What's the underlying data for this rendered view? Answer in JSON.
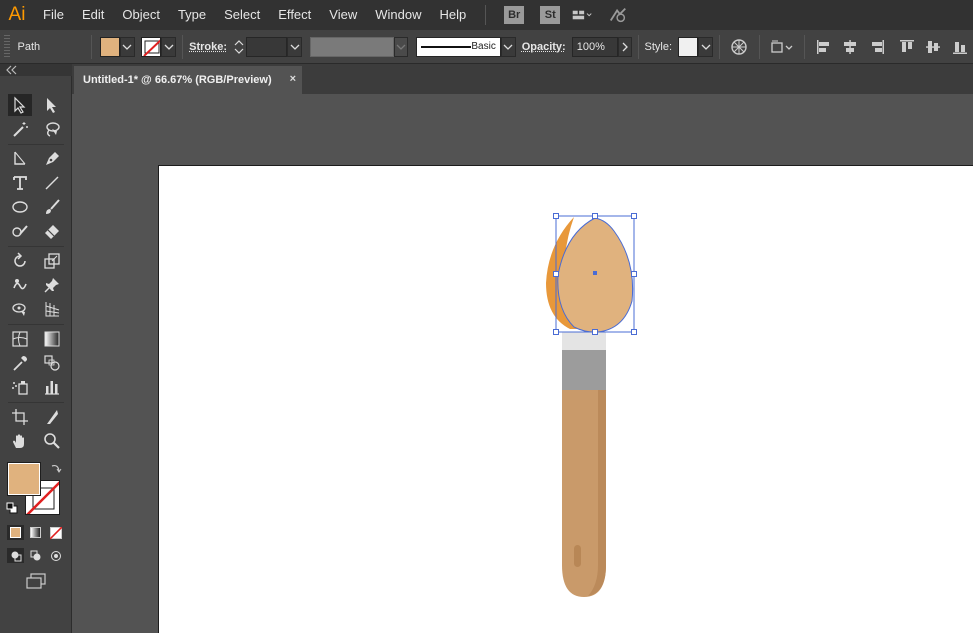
{
  "app": {
    "logo": "Ai"
  },
  "menu": [
    "File",
    "Edit",
    "Object",
    "Type",
    "Select",
    "Effect",
    "View",
    "Window",
    "Help"
  ],
  "menubar_badges": [
    "Br",
    "St"
  ],
  "control": {
    "selection_label": "Path",
    "stroke_label": "Stroke:",
    "stroke_value": "",
    "brush_label": "Basic",
    "opacity_label": "Opacity:",
    "opacity_value": "100%",
    "style_label": "Style:"
  },
  "document": {
    "tab_title": "Untitled-1* @ 66.67% (RGB/Preview)",
    "close": "×"
  },
  "colors": {
    "fill": "#e0b27e",
    "accent_orange": "#ff9a00",
    "handle_fill": "#e0b27e",
    "handle_shade": "#c99563",
    "ferrule_light": "#e2e2e2",
    "ferrule_dark": "#9c9c9c",
    "sponge_back": "#e89a3c",
    "selection": "#4a6cd4"
  },
  "tools": [
    "selection-tool",
    "direct-selection-tool",
    "magic-wand-tool",
    "lasso-tool",
    "line-segment-tool",
    "pen-tool",
    "type-tool",
    "line-tool",
    "ellipse-tool",
    "paintbrush-tool",
    "shaper-tool",
    "eraser-tool",
    "rotate-tool",
    "scale-tool",
    "warp-tool",
    "puppet-warp-tool",
    "shape-builder-tool",
    "perspective-grid-tool",
    "mesh-tool",
    "gradient-tool",
    "eyedropper-tool",
    "blend-tool",
    "symbol-sprayer-tool",
    "column-graph-tool",
    "artboard-tool",
    "slice-tool",
    "hand-tool",
    "zoom-tool"
  ]
}
